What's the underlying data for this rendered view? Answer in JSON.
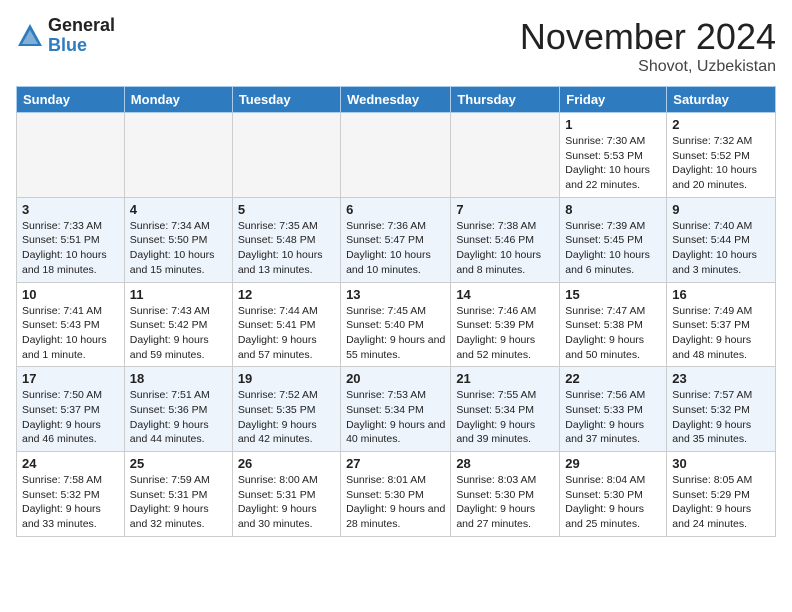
{
  "header": {
    "logo_general": "General",
    "logo_blue": "Blue",
    "month_title": "November 2024",
    "location": "Shovot, Uzbekistan"
  },
  "days_of_week": [
    "Sunday",
    "Monday",
    "Tuesday",
    "Wednesday",
    "Thursday",
    "Friday",
    "Saturday"
  ],
  "weeks": [
    [
      {
        "day": "",
        "info": ""
      },
      {
        "day": "",
        "info": ""
      },
      {
        "day": "",
        "info": ""
      },
      {
        "day": "",
        "info": ""
      },
      {
        "day": "",
        "info": ""
      },
      {
        "day": "1",
        "info": "Sunrise: 7:30 AM\nSunset: 5:53 PM\nDaylight: 10 hours and 22 minutes."
      },
      {
        "day": "2",
        "info": "Sunrise: 7:32 AM\nSunset: 5:52 PM\nDaylight: 10 hours and 20 minutes."
      }
    ],
    [
      {
        "day": "3",
        "info": "Sunrise: 7:33 AM\nSunset: 5:51 PM\nDaylight: 10 hours and 18 minutes."
      },
      {
        "day": "4",
        "info": "Sunrise: 7:34 AM\nSunset: 5:50 PM\nDaylight: 10 hours and 15 minutes."
      },
      {
        "day": "5",
        "info": "Sunrise: 7:35 AM\nSunset: 5:48 PM\nDaylight: 10 hours and 13 minutes."
      },
      {
        "day": "6",
        "info": "Sunrise: 7:36 AM\nSunset: 5:47 PM\nDaylight: 10 hours and 10 minutes."
      },
      {
        "day": "7",
        "info": "Sunrise: 7:38 AM\nSunset: 5:46 PM\nDaylight: 10 hours and 8 minutes."
      },
      {
        "day": "8",
        "info": "Sunrise: 7:39 AM\nSunset: 5:45 PM\nDaylight: 10 hours and 6 minutes."
      },
      {
        "day": "9",
        "info": "Sunrise: 7:40 AM\nSunset: 5:44 PM\nDaylight: 10 hours and 3 minutes."
      }
    ],
    [
      {
        "day": "10",
        "info": "Sunrise: 7:41 AM\nSunset: 5:43 PM\nDaylight: 10 hours and 1 minute."
      },
      {
        "day": "11",
        "info": "Sunrise: 7:43 AM\nSunset: 5:42 PM\nDaylight: 9 hours and 59 minutes."
      },
      {
        "day": "12",
        "info": "Sunrise: 7:44 AM\nSunset: 5:41 PM\nDaylight: 9 hours and 57 minutes."
      },
      {
        "day": "13",
        "info": "Sunrise: 7:45 AM\nSunset: 5:40 PM\nDaylight: 9 hours and 55 minutes."
      },
      {
        "day": "14",
        "info": "Sunrise: 7:46 AM\nSunset: 5:39 PM\nDaylight: 9 hours and 52 minutes."
      },
      {
        "day": "15",
        "info": "Sunrise: 7:47 AM\nSunset: 5:38 PM\nDaylight: 9 hours and 50 minutes."
      },
      {
        "day": "16",
        "info": "Sunrise: 7:49 AM\nSunset: 5:37 PM\nDaylight: 9 hours and 48 minutes."
      }
    ],
    [
      {
        "day": "17",
        "info": "Sunrise: 7:50 AM\nSunset: 5:37 PM\nDaylight: 9 hours and 46 minutes."
      },
      {
        "day": "18",
        "info": "Sunrise: 7:51 AM\nSunset: 5:36 PM\nDaylight: 9 hours and 44 minutes."
      },
      {
        "day": "19",
        "info": "Sunrise: 7:52 AM\nSunset: 5:35 PM\nDaylight: 9 hours and 42 minutes."
      },
      {
        "day": "20",
        "info": "Sunrise: 7:53 AM\nSunset: 5:34 PM\nDaylight: 9 hours and 40 minutes."
      },
      {
        "day": "21",
        "info": "Sunrise: 7:55 AM\nSunset: 5:34 PM\nDaylight: 9 hours and 39 minutes."
      },
      {
        "day": "22",
        "info": "Sunrise: 7:56 AM\nSunset: 5:33 PM\nDaylight: 9 hours and 37 minutes."
      },
      {
        "day": "23",
        "info": "Sunrise: 7:57 AM\nSunset: 5:32 PM\nDaylight: 9 hours and 35 minutes."
      }
    ],
    [
      {
        "day": "24",
        "info": "Sunrise: 7:58 AM\nSunset: 5:32 PM\nDaylight: 9 hours and 33 minutes."
      },
      {
        "day": "25",
        "info": "Sunrise: 7:59 AM\nSunset: 5:31 PM\nDaylight: 9 hours and 32 minutes."
      },
      {
        "day": "26",
        "info": "Sunrise: 8:00 AM\nSunset: 5:31 PM\nDaylight: 9 hours and 30 minutes."
      },
      {
        "day": "27",
        "info": "Sunrise: 8:01 AM\nSunset: 5:30 PM\nDaylight: 9 hours and 28 minutes."
      },
      {
        "day": "28",
        "info": "Sunrise: 8:03 AM\nSunset: 5:30 PM\nDaylight: 9 hours and 27 minutes."
      },
      {
        "day": "29",
        "info": "Sunrise: 8:04 AM\nSunset: 5:30 PM\nDaylight: 9 hours and 25 minutes."
      },
      {
        "day": "30",
        "info": "Sunrise: 8:05 AM\nSunset: 5:29 PM\nDaylight: 9 hours and 24 minutes."
      }
    ]
  ]
}
